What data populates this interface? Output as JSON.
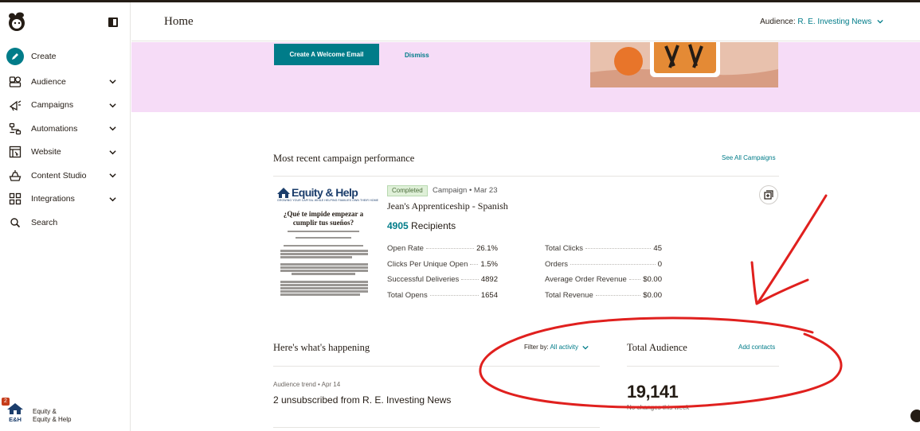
{
  "sidebar": {
    "items": [
      {
        "label": "Create"
      },
      {
        "label": "Audience"
      },
      {
        "label": "Campaigns"
      },
      {
        "label": "Automations"
      },
      {
        "label": "Website"
      },
      {
        "label": "Content Studio"
      },
      {
        "label": "Integrations"
      },
      {
        "label": "Search"
      }
    ],
    "account": {
      "notifications": "2",
      "logo_text": "E&H",
      "name_line1": "Equity &",
      "name_line2": "Equity & Help"
    }
  },
  "header": {
    "title": "Home",
    "audience_label": "Audience:",
    "audience_value": "R. E. Investing News"
  },
  "banner": {
    "create_button": "Create A Welcome Email",
    "dismiss": "Dismiss"
  },
  "campaigns": {
    "title": "Most recent campaign performance",
    "see_all": "See All Campaigns",
    "status": "Completed",
    "meta": "Campaign • Mar 23",
    "name": "Jean's Apprenticeship - Spanish",
    "recipients_count": "4905",
    "recipients_label": "Recipients",
    "thumbnail": {
      "brand": "Equity & Help",
      "tagline": "GROWING YOUR CAPITAL WHILE HELPING FAMILIES OWN THEIR HOME",
      "headline": "¿Qué te impide empezar a cumplir tus sueños?"
    },
    "stats_left": [
      {
        "label": "Open Rate",
        "value": "26.1%"
      },
      {
        "label": "Clicks Per Unique Open",
        "value": "1.5%"
      },
      {
        "label": "Successful Deliveries",
        "value": "4892"
      },
      {
        "label": "Total Opens",
        "value": "1654"
      }
    ],
    "stats_right": [
      {
        "label": "Total Clicks",
        "value": "45"
      },
      {
        "label": "Orders",
        "value": "0"
      },
      {
        "label": "Average Order Revenue",
        "value": "$0.00"
      },
      {
        "label": "Total Revenue",
        "value": "$0.00"
      }
    ]
  },
  "happening": {
    "title": "Here's what's happening",
    "filter_label": "Filter by:",
    "filter_value": "All activity",
    "trend_meta": "Audience trend  • Apr 14",
    "trend_text": "2 unsubscribed from R. E. Investing News"
  },
  "audience_panel": {
    "title": "Total Audience",
    "add_contacts": "Add contacts",
    "count": "19,141",
    "subtext": "No changes this week"
  },
  "colors": {
    "accent": "#007c89",
    "banner_bg": "#f6dcf7",
    "annotation": "#e0201e"
  }
}
